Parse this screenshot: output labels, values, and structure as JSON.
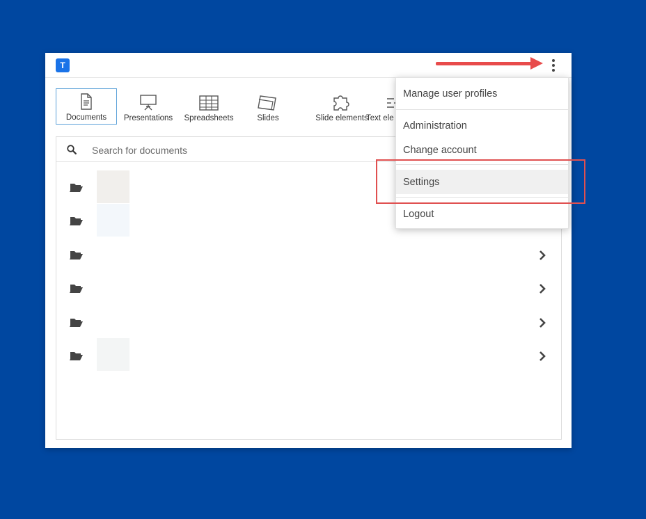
{
  "app": {
    "logo_letter": "T",
    "brand_color": "#1a73e8"
  },
  "toolbar": {
    "items": [
      {
        "label": "Documents",
        "icon": "document-icon",
        "active": true
      },
      {
        "label": "Presentations",
        "icon": "presentation-icon",
        "active": false
      },
      {
        "label": "Spreadsheets",
        "icon": "spreadsheet-icon",
        "active": false
      },
      {
        "label": "Slides",
        "icon": "slides-icon",
        "active": false
      },
      {
        "label": "Slide elements",
        "icon": "puzzle-icon",
        "active": false
      },
      {
        "label": "Text ele",
        "icon": "text-elements-icon",
        "active": false
      }
    ]
  },
  "search": {
    "placeholder": "Search for documents",
    "value": ""
  },
  "list": {
    "rows": [
      {
        "icon": "folder-open-icon",
        "thumb_color": "#f1efec",
        "has_chevron": false
      },
      {
        "icon": "folder-open-icon",
        "thumb_color": "#f3f7fb",
        "has_chevron": false
      },
      {
        "icon": "folder-open-icon",
        "thumb_color": "",
        "has_chevron": true
      },
      {
        "icon": "folder-open-icon",
        "thumb_color": "",
        "has_chevron": true
      },
      {
        "icon": "folder-open-icon",
        "thumb_color": "",
        "has_chevron": true
      },
      {
        "icon": "folder-open-icon",
        "thumb_color": "#f3f5f5",
        "has_chevron": true
      }
    ]
  },
  "menu": {
    "items": [
      {
        "label": "Manage user profiles"
      },
      {
        "label": "Administration"
      },
      {
        "label": "Change account"
      },
      {
        "label": "Settings",
        "highlighted": true
      },
      {
        "label": "Logout"
      }
    ]
  },
  "annotations": {
    "color": "#e84b4b"
  },
  "colors": {
    "background": "#0047a0",
    "active_tab_border": "#5aa0d8"
  }
}
